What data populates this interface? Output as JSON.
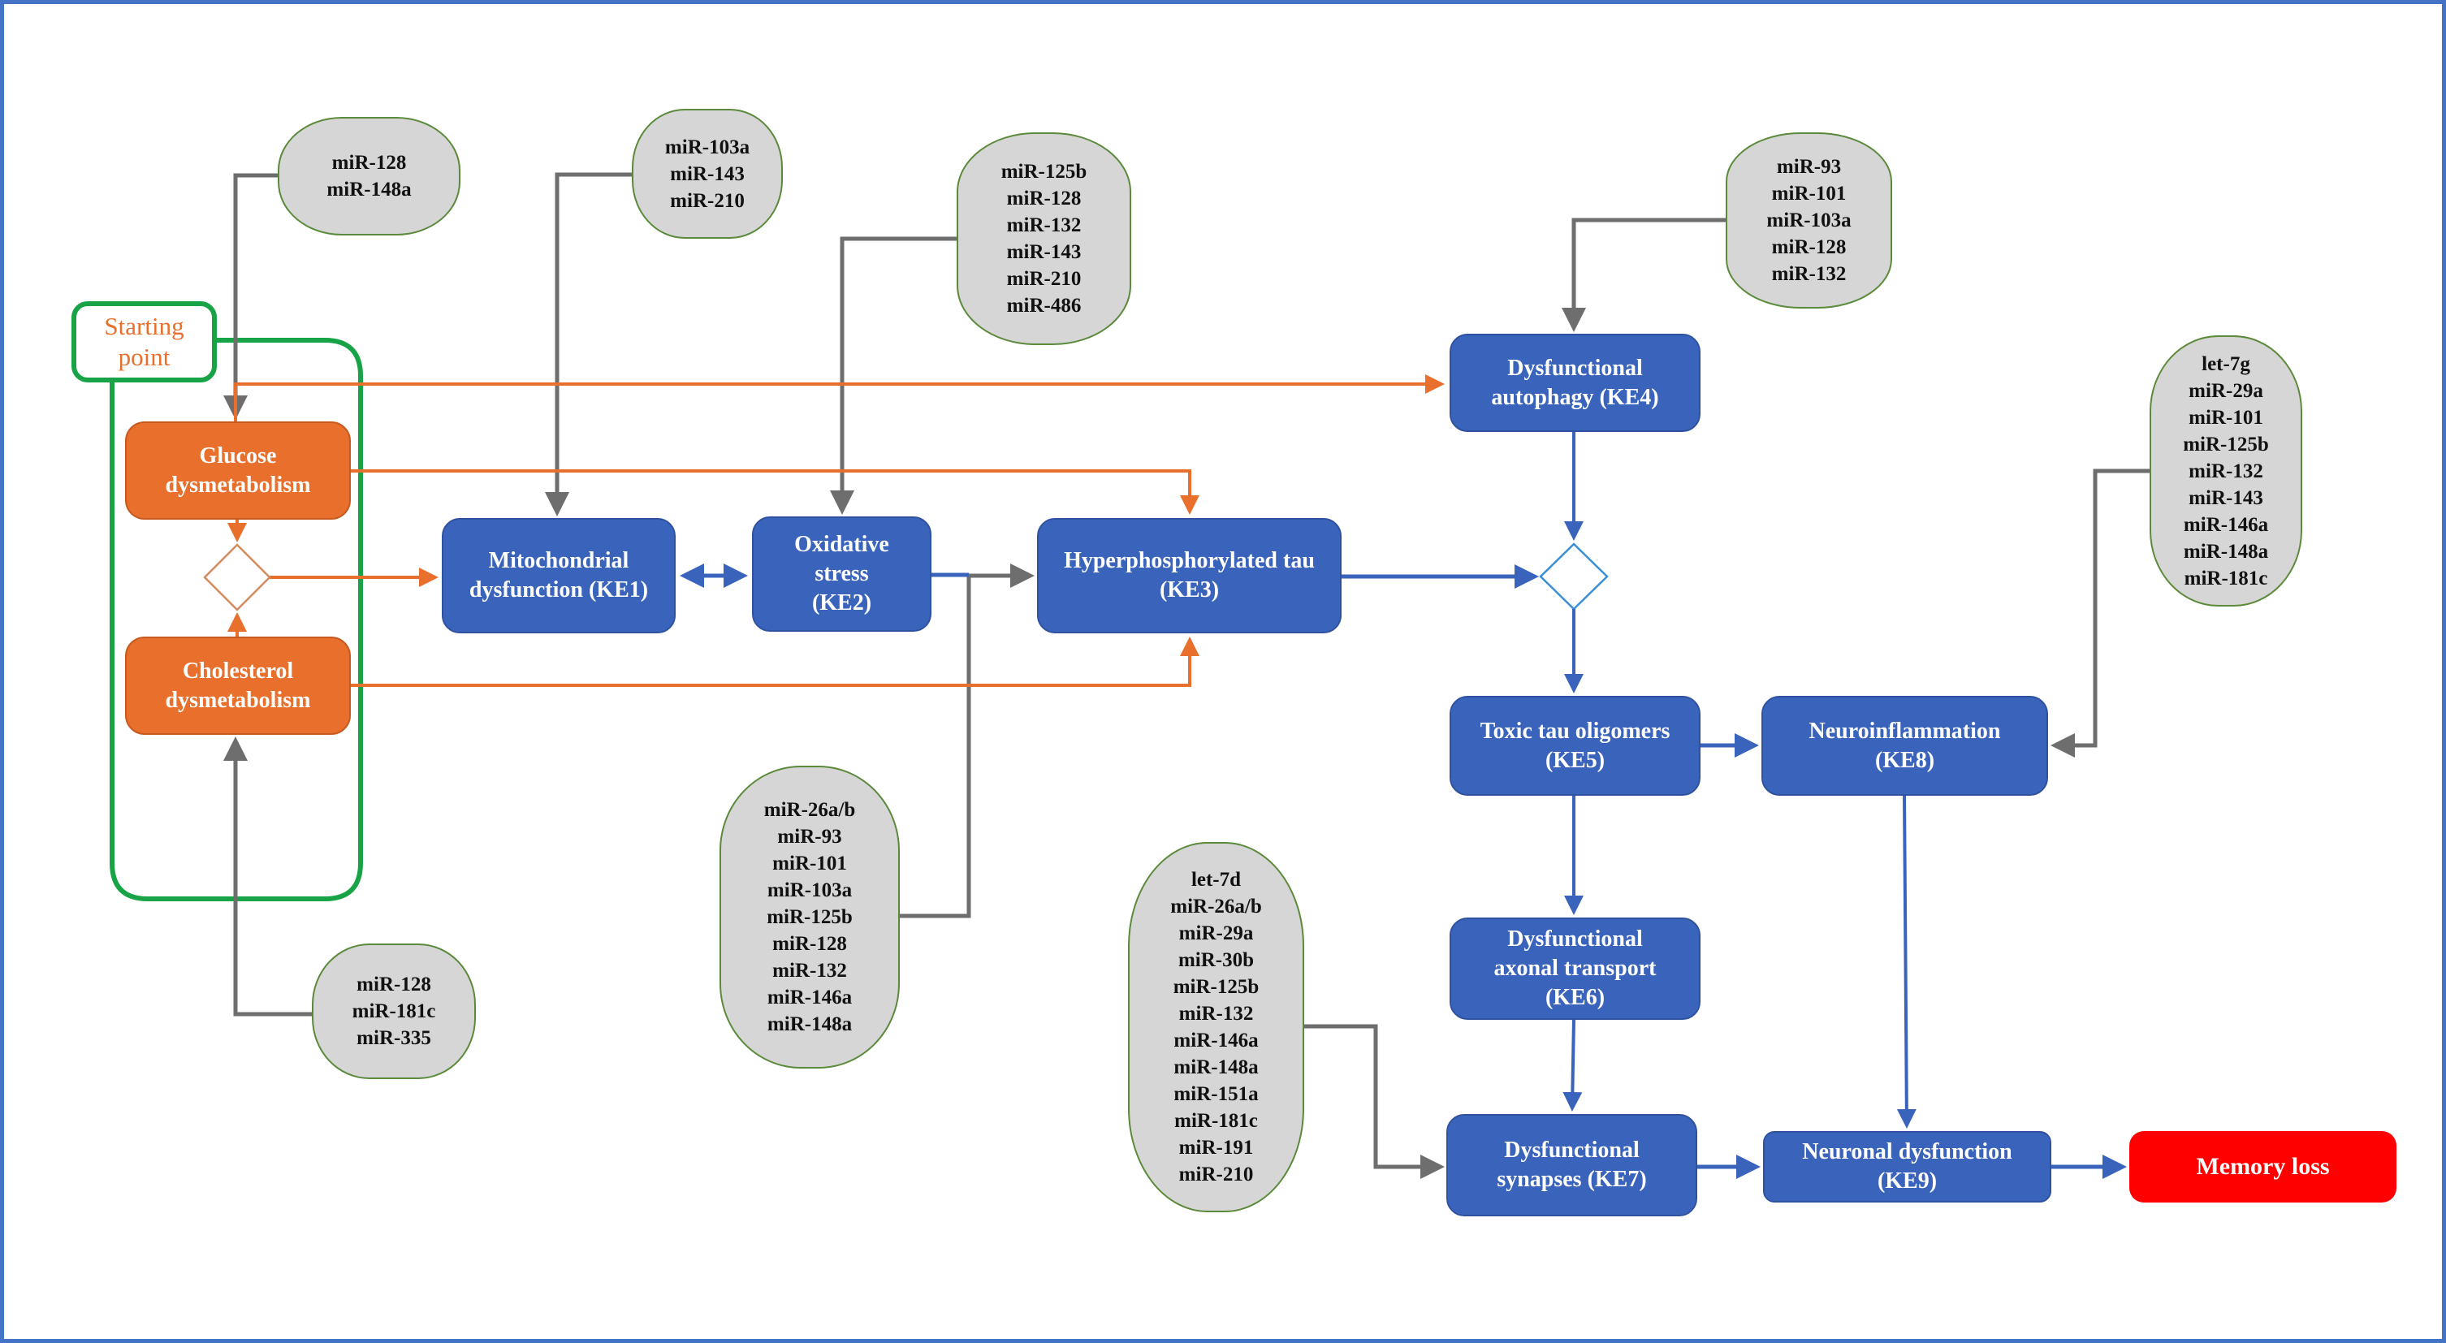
{
  "colors": {
    "frame": "#4472C4",
    "key_event": "#3A64BB",
    "metabolic": "#E86F2C",
    "outcome": "#FF0000",
    "mirna_box": "#D6D6D6",
    "mirna_border": "#5A8A3A",
    "starting_point_border": "#17A346",
    "mirna_link": "#6E6E6E"
  },
  "starting_point": {
    "label": "Starting point"
  },
  "metabolic_events": {
    "glucose": {
      "label": "Glucose dysmetabolism"
    },
    "cholesterol": {
      "label": "Cholesterol dysmetabolism"
    }
  },
  "key_events": {
    "ke1": {
      "label": "Mitochondrial dysfunction (KE1)"
    },
    "ke2": {
      "label": "Oxidative stress (KE2)"
    },
    "ke3": {
      "label": "Hyperphosphorylated tau (KE3)"
    },
    "ke4": {
      "label": "Dysfunctional autophagy (KE4)"
    },
    "ke5": {
      "label": "Toxic tau oligomers (KE5)"
    },
    "ke6": {
      "label": "Dysfunctional axonal transport (KE6)"
    },
    "ke7": {
      "label": "Dysfunctional synapses (KE7)"
    },
    "ke8": {
      "label": "Neuroinflammation (KE8)"
    },
    "ke9": {
      "label": "Neuronal dysfunction (KE9)"
    }
  },
  "adverse_outcome": {
    "label": "Memory loss"
  },
  "mirna_groups": {
    "glucose": [
      "miR-128",
      "miR-148a"
    ],
    "ke1": [
      "miR-103a",
      "miR-143",
      "miR-210"
    ],
    "ke2": [
      "miR-125b",
      "miR-128",
      "miR-132",
      "miR-143",
      "miR-210",
      "miR-486"
    ],
    "ke4": [
      "miR-93",
      "miR-101",
      "miR-103a",
      "miR-128",
      "miR-132"
    ],
    "ke8": [
      "let-7g",
      "miR-29a",
      "miR-101",
      "miR-125b",
      "miR-132",
      "miR-143",
      "miR-146a",
      "miR-148a",
      "miR-181c"
    ],
    "ke3": [
      "miR-26a/b",
      "miR-93",
      "miR-101",
      "miR-103a",
      "miR-125b",
      "miR-128",
      "miR-132",
      "miR-146a",
      "miR-148a"
    ],
    "ke7": [
      "let-7d",
      "miR-26a/b",
      "miR-29a",
      "miR-30b",
      "miR-125b",
      "miR-132",
      "miR-146a",
      "miR-148a",
      "miR-151a",
      "miR-181c",
      "miR-191",
      "miR-210"
    ],
    "cholesterol": [
      "miR-128",
      "miR-181c",
      "miR-335"
    ]
  },
  "edges": [
    {
      "from": "mirna-glucose",
      "to": "glucose",
      "type": "mirna"
    },
    {
      "from": "mirna-ke1",
      "to": "ke1",
      "type": "mirna"
    },
    {
      "from": "mirna-ke2",
      "to": "ke2",
      "type": "mirna"
    },
    {
      "from": "mirna-ke4",
      "to": "ke4",
      "type": "mirna"
    },
    {
      "from": "mirna-ke8",
      "to": "ke8",
      "type": "mirna"
    },
    {
      "from": "mirna-ke3",
      "to": "ke3",
      "type": "mirna"
    },
    {
      "from": "mirna-ke7",
      "to": "ke7",
      "type": "mirna"
    },
    {
      "from": "mirna-cholesterol",
      "to": "cholesterol",
      "type": "mirna"
    },
    {
      "from": "glucose",
      "to": "metabolic-junction",
      "type": "metabolic"
    },
    {
      "from": "cholesterol",
      "to": "metabolic-junction",
      "type": "metabolic"
    },
    {
      "from": "metabolic-junction",
      "to": "ke1",
      "type": "metabolic"
    },
    {
      "from": "glucose",
      "to": "ke4",
      "type": "metabolic"
    },
    {
      "from": "glucose",
      "to": "ke3",
      "type": "metabolic"
    },
    {
      "from": "cholesterol",
      "to": "ke3",
      "type": "metabolic"
    },
    {
      "from": "ke1",
      "to": "ke2",
      "type": "bidirectional"
    },
    {
      "from": "ke2",
      "to": "ke3",
      "type": "key"
    },
    {
      "from": "ke3",
      "to": "tau-junction",
      "type": "key"
    },
    {
      "from": "ke4",
      "to": "tau-junction",
      "type": "key"
    },
    {
      "from": "tau-junction",
      "to": "ke5",
      "type": "key"
    },
    {
      "from": "ke5",
      "to": "ke8",
      "type": "key"
    },
    {
      "from": "ke5",
      "to": "ke6",
      "type": "key"
    },
    {
      "from": "ke6",
      "to": "ke7",
      "type": "key"
    },
    {
      "from": "ke7",
      "to": "ke9",
      "type": "key"
    },
    {
      "from": "ke8",
      "to": "ke9",
      "type": "key"
    },
    {
      "from": "ke9",
      "to": "memory-loss",
      "type": "key"
    }
  ]
}
